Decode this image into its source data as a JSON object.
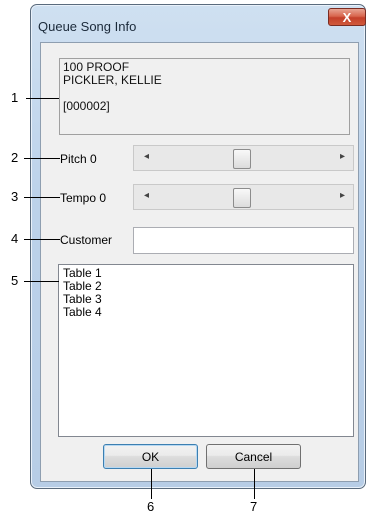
{
  "window": {
    "title": "Queue Song Info",
    "close_label": "X"
  },
  "song_info": {
    "lines": [
      "100 PROOF",
      "PICKLER, KELLIE",
      "",
      "[000002]"
    ]
  },
  "pitch": {
    "label": "Pitch 0",
    "left_arrow": "◂",
    "right_arrow": "▸"
  },
  "tempo": {
    "label": "Tempo 0",
    "left_arrow": "◂",
    "right_arrow": "▸"
  },
  "customer": {
    "label": "Customer",
    "value": ""
  },
  "tables": [
    "Table 1",
    "Table 2",
    "Table 3",
    "Table 4"
  ],
  "buttons": {
    "ok": "OK",
    "cancel": "Cancel"
  },
  "callouts": [
    "1",
    "2",
    "3",
    "4",
    "5",
    "6",
    "7"
  ]
}
